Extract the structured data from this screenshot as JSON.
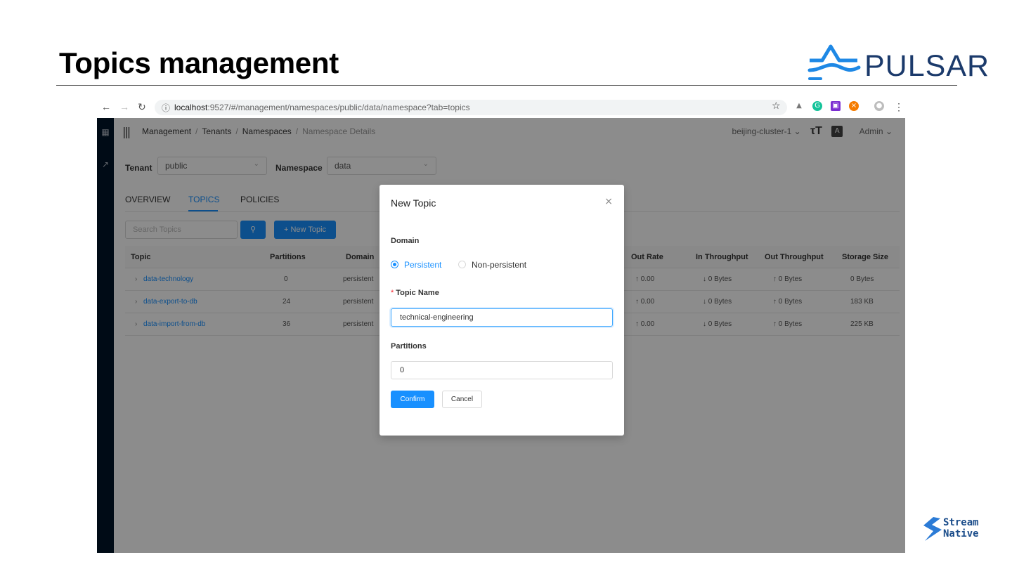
{
  "slide": {
    "title": "Topics management",
    "logo_text": "PULSAR",
    "footer_logo_line1": "Stream",
    "footer_logo_line2": "Native"
  },
  "browser": {
    "url_host": "localhost",
    "url_rest": ":9527/#/management/namespaces/public/data/namespace?tab=topics"
  },
  "header": {
    "breadcrumbs": [
      "Management",
      "Tenants",
      "Namespaces",
      "Namespace Details"
    ],
    "cluster": "beijing-cluster-1",
    "user": "Admin"
  },
  "filters": {
    "tenant_label": "Tenant",
    "tenant_value": "public",
    "namespace_label": "Namespace",
    "namespace_value": "data"
  },
  "tabs": [
    {
      "label": "OVERVIEW"
    },
    {
      "label": "TOPICS"
    },
    {
      "label": "POLICIES"
    }
  ],
  "toolbar": {
    "search_placeholder": "Search Topics",
    "new_topic_label": "+ New Topic"
  },
  "table": {
    "columns": [
      "Topic",
      "Partitions",
      "Domain",
      "Out Rate",
      "In Throughput",
      "Out Throughput",
      "Storage Size"
    ],
    "rows": [
      {
        "topic": "data-technology",
        "partitions": "0",
        "domain": "persistent",
        "out_rate": "↑ 0.00",
        "in_throughput": "↓ 0 Bytes",
        "out_throughput": "↑ 0 Bytes",
        "storage": "0 Bytes"
      },
      {
        "topic": "data-export-to-db",
        "partitions": "24",
        "domain": "persistent",
        "out_rate": "↑ 0.00",
        "in_throughput": "↓ 0 Bytes",
        "out_throughput": "↑ 0 Bytes",
        "storage": "183 KB"
      },
      {
        "topic": "data-import-from-db",
        "partitions": "36",
        "domain": "persistent",
        "out_rate": "↑ 0.00",
        "in_throughput": "↓ 0 Bytes",
        "out_throughput": "↑ 0 Bytes",
        "storage": "225 KB"
      }
    ]
  },
  "modal": {
    "title": "New Topic",
    "domain_label": "Domain",
    "option_persistent": "Persistent",
    "option_non_persistent": "Non-persistent",
    "topic_name_label": "Topic Name",
    "topic_name_value": "technical-engineering",
    "partitions_label": "Partitions",
    "partitions_value": "0",
    "confirm_label": "Confirm",
    "cancel_label": "Cancel"
  },
  "colors": {
    "primary": "#1890ff",
    "sidebar": "#001529"
  }
}
